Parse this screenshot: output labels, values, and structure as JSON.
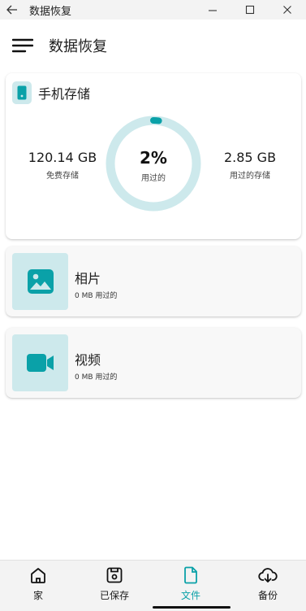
{
  "window": {
    "title": "数据恢复",
    "back_icon": "arrow-left-icon",
    "controls": [
      "minimize-icon",
      "maximize-icon",
      "close-icon"
    ]
  },
  "header": {
    "menu_icon": "hamburger-menu-icon",
    "title": "数据恢复"
  },
  "storage": {
    "title": "手机存储",
    "icon": "phone-icon",
    "free_value": "120.14 GB",
    "free_label": "免费存储",
    "used_percent_text": "2%",
    "used_percent": 0.02,
    "used_percent_label": "用过的",
    "used_value": "2.85 GB",
    "used_label": "用过的存储",
    "colors": {
      "ring_track": "#cde9ec",
      "ring_fill": "#0aa1a8"
    }
  },
  "media": [
    {
      "name": "相片",
      "sub": "0 MB 用过的",
      "icon": "image-icon"
    },
    {
      "name": "视频",
      "sub": "0 MB 用过的",
      "icon": "video-camera-icon"
    }
  ],
  "nav": {
    "items": [
      {
        "label": "家",
        "icon": "home-icon"
      },
      {
        "label": "已保存",
        "icon": "save-icon"
      },
      {
        "label": "文件",
        "icon": "file-icon",
        "active": true
      },
      {
        "label": "备份",
        "icon": "cloud-download-icon"
      }
    ],
    "accent_color": "#0aa1a8"
  }
}
